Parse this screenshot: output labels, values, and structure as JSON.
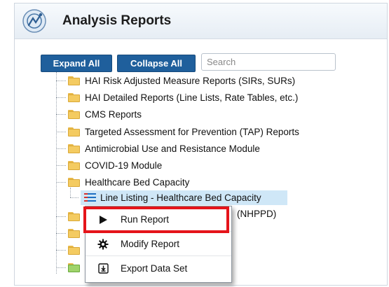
{
  "header": {
    "title": "Analysis Reports",
    "logo_icon": "analysis-logo-icon"
  },
  "toolbar": {
    "expand_label": "Expand All",
    "collapse_label": "Collapse All",
    "search_placeholder": "Search"
  },
  "tree": {
    "folders": [
      {
        "label": "HAI Risk Adjusted Measure Reports (SIRs, SURs)"
      },
      {
        "label": "HAI Detailed Reports (Line Lists, Rate Tables, etc.)"
      },
      {
        "label": "CMS Reports"
      },
      {
        "label": "Targeted Assessment for Prevention (TAP) Reports"
      },
      {
        "label": "Antimicrobial Use and Resistance Module"
      },
      {
        "label": "COVID-19 Module"
      },
      {
        "label": "Healthcare Bed Capacity"
      }
    ],
    "selected_report": "Line Listing - Healthcare Bed Capacity",
    "obscured_partial": "(NHPPD)"
  },
  "context_menu": {
    "items": [
      {
        "label": "Run Report",
        "icon": "play-icon"
      },
      {
        "label": "Modify Report",
        "icon": "gear-icon"
      },
      {
        "label": "Export Data Set",
        "icon": "export-icon"
      }
    ],
    "highlight_color": "#e5141a"
  },
  "colors": {
    "button": "#1f5f9c",
    "selection": "#cfe7f7",
    "folder": "#f4cb61"
  }
}
